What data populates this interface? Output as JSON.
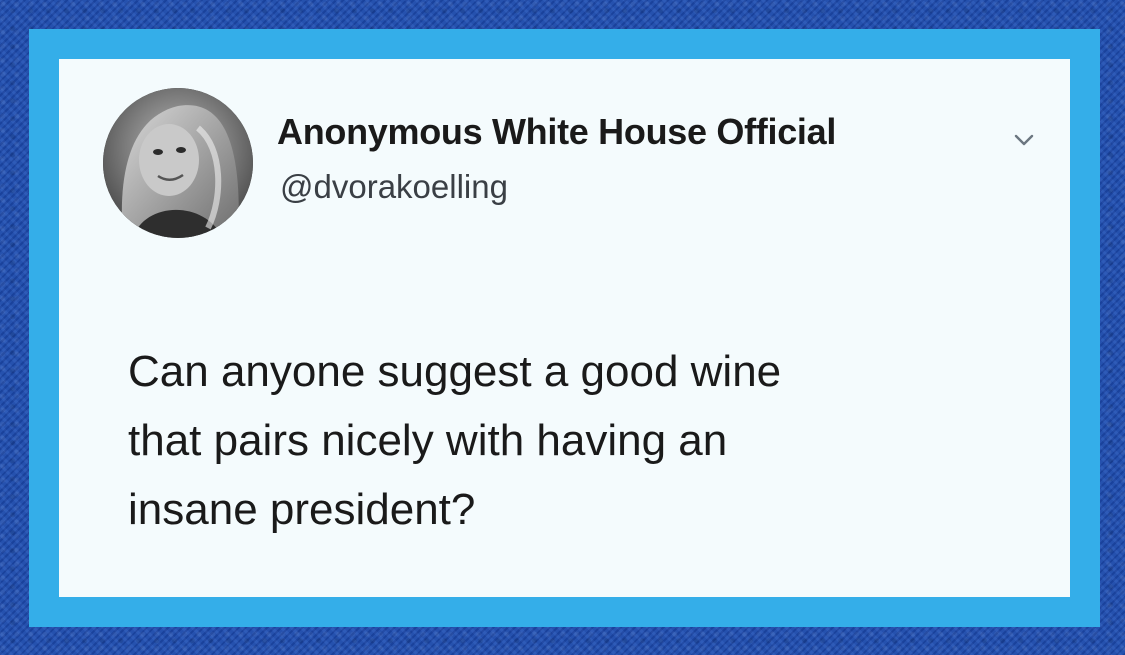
{
  "tweet": {
    "author": {
      "display_name": "Anonymous White House Official",
      "handle": "@dvorakoelling",
      "avatar_icon": "profile-photo-avatar"
    },
    "menu_icon": "chevron-down-icon",
    "text_lines": [
      "Can anyone suggest a good wine",
      "that pairs nicely with having an",
      "insane president?"
    ]
  },
  "colors": {
    "outer_background": "#1f4fae",
    "frame": "#34aee9",
    "card": "#f4fbfd",
    "text": "#1a1a1a",
    "handle_text": "#3a3f45"
  }
}
